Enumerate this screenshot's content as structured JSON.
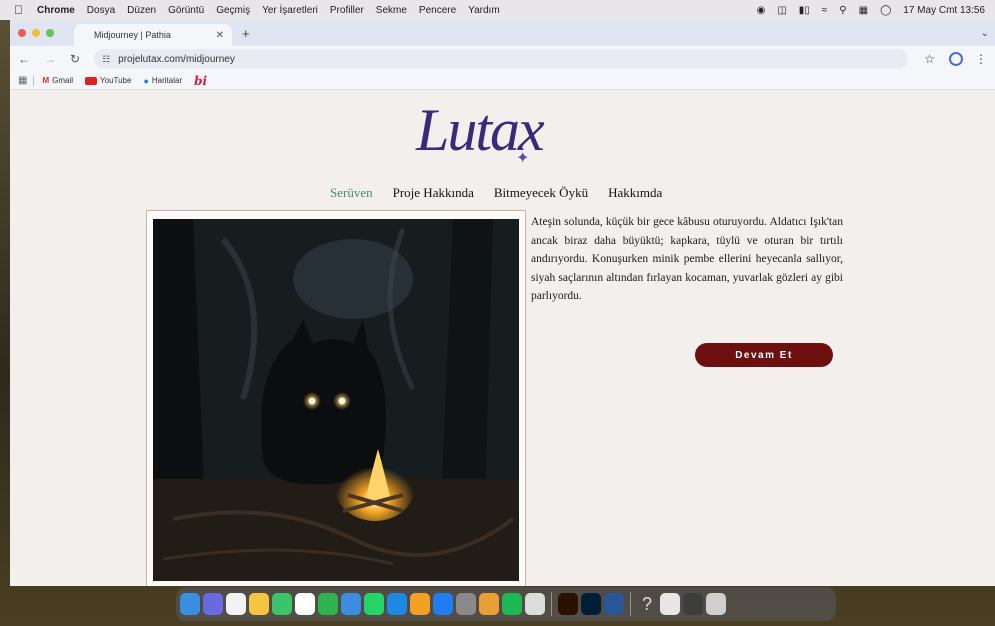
{
  "menubar": {
    "app_name": "Chrome",
    "menus": [
      "Dosya",
      "Düzen",
      "Görüntü",
      "Geçmiş",
      "Yer İşaretleri",
      "Profiller",
      "Sekme",
      "Pencere",
      "Yardım"
    ],
    "datetime": "17 May Cmt 13:56"
  },
  "browser": {
    "tab_title": "Midjourney | Pathia",
    "url": "projelutax.com/midjourney",
    "bookmarks": {
      "gmail": "Gmail",
      "youtube": "YouTube",
      "maps": "Haritalar",
      "bi": "bi"
    }
  },
  "site": {
    "logo": "Lutax",
    "nav": [
      "Serüven",
      "Proje Hakkında",
      "Bitmeyecek Öykü",
      "Hakkımda"
    ],
    "story": "Ateşin solunda, küçük bir gece kâbusu oturuyordu. Aldatıcı Işık'tan ancak biraz daha büyüktü; kapkara, tüylü ve oturan bir tırtılı andırıyordu. Konuşurken minik pembe ellerini heyecanla sallıyor, siyah saçlarının altından fırlayan kocaman, yuvarlak gözleri ay gibi parlıyordu.",
    "cta": "Devam Et"
  },
  "colors": {
    "accent_nav": "#4b8c77",
    "cta_bg": "#6e1010",
    "logo": "#3a2a7a"
  }
}
